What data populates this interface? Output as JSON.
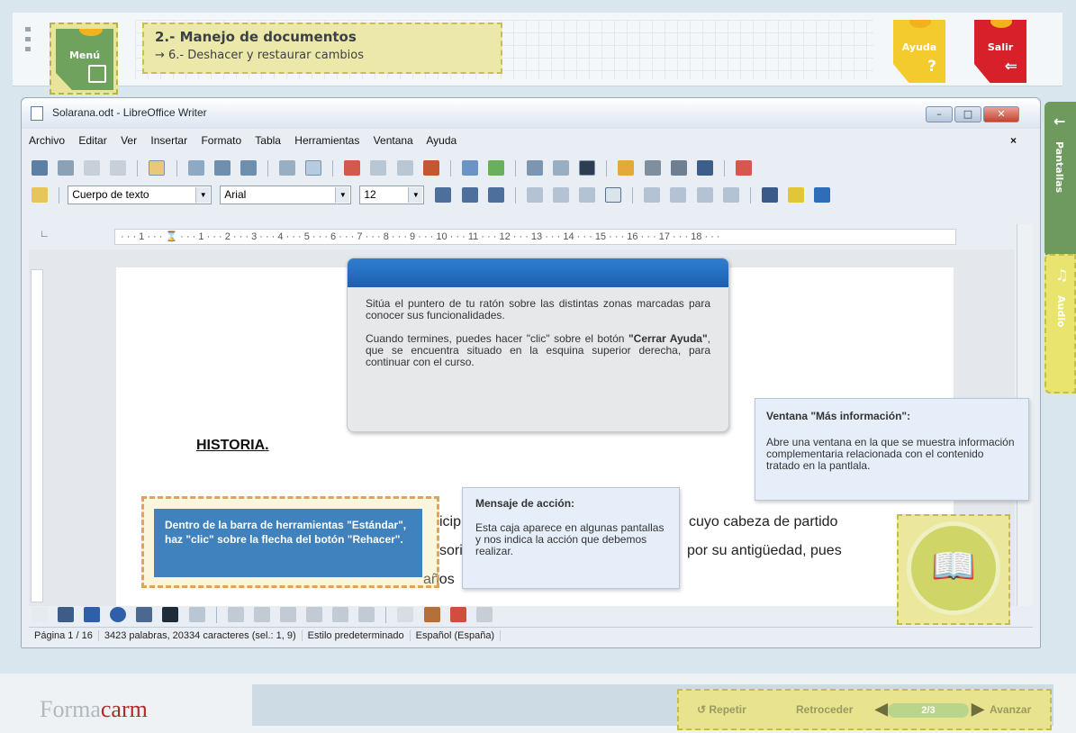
{
  "course": {
    "menu_label": "Menú",
    "section_title": "2.- Manejo de documentos",
    "subsection": "6.- Deshacer y restaurar cambios",
    "help_label": "Ayuda",
    "exit_label": "Salir",
    "tab_screens": "Pantallas",
    "tab_audio": "Audio"
  },
  "window": {
    "title": "Solarana.odt - LibreOffice Writer",
    "menu": [
      "Archivo",
      "Editar",
      "Ver",
      "Insertar",
      "Formato",
      "Tabla",
      "Herramientas",
      "Ventana",
      "Ayuda"
    ]
  },
  "formatting": {
    "paragraph_style": "Cuerpo de texto",
    "font_name": "Arial",
    "font_size": "12"
  },
  "ruler": {
    "marks": "· · · 1 · · · ⌛ · · · 1 · · · 2 · · · 3 · · · 4 · · · 5 · · · 6 · · · 7 · · · 8 · · · 9 · · · 10 · · · 11 · · · 12 · · · 13 · · · 14 · · · 15 · · · 16 · · · 17 · · · 18 · · ·"
  },
  "document": {
    "heading": "HISTORIA",
    "heading_dot": ".",
    "line1_a": "icipi",
    "line1_b": "cuyo cabeza de partido",
    "line2_a": "sori",
    "line2_b": "por su antigüedad, pues",
    "line3": "años"
  },
  "help_popup": {
    "para1": "Sitúa el puntero de tu ratón sobre las distintas zonas marcadas para conocer sus funcionalidades.",
    "para2_pre": "Cuando termines, puedes hacer \"clic\" sobre el botón ",
    "para2_bold": "\"Cerrar Ayuda\"",
    "para2_post": ", que se encuentra situado en la esquina superior derecha, para continuar con el curso."
  },
  "info_popup": {
    "title": "Ventana \"Más información\":",
    "body": "Abre una ventana en la que se muestra información complementaria relacionada con el contenido tratado en la pantlala."
  },
  "action_popup": {
    "title": "Mensaje de acción:",
    "body": "Esta caja aparece en algunas pantallas y nos indica la acción que debemos realizar."
  },
  "instruction": {
    "text": "Dentro de la barra de herramientas \"Estándar\", haz \"clic\" sobre la flecha del botón \"Rehacer\"."
  },
  "status": {
    "page": "Página 1 / 16",
    "words": "3423 palabras, 20334 caracteres (sel.: 1, 9)",
    "style": "Estilo predeterminado",
    "lang": "Español (España)"
  },
  "nav": {
    "repeat": "Repetir",
    "back": "Retroceder",
    "pager": "2/3",
    "next": "Avanzar"
  },
  "brand": {
    "logo_a": "Forma",
    "logo_b": "carm"
  }
}
